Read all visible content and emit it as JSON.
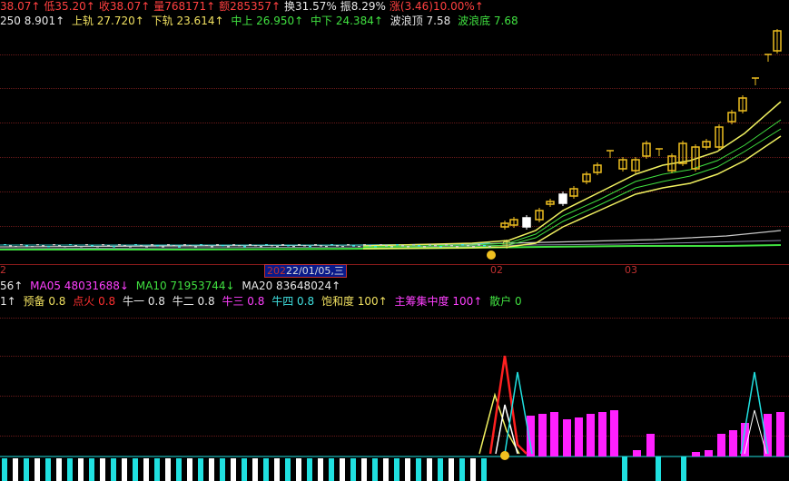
{
  "quote_bar": {
    "open_tail": {
      "text": "38.07↑",
      "color": "#ff4040"
    },
    "low": {
      "text": "低35.20↑",
      "color": "#ff4040"
    },
    "close": {
      "text": "收38.07↑",
      "color": "#ff4040"
    },
    "volume": {
      "text": "量768171↑",
      "color": "#ff4040"
    },
    "amount": {
      "text": "额285357↑",
      "color": "#ff4040"
    },
    "turnover": {
      "text": "换31.57%",
      "color": "#e8e8e8"
    },
    "amplitude": {
      "text": "振8.29%",
      "color": "#e8e8e8"
    },
    "change": {
      "text": "涨(3.46)10.00%↑",
      "color": "#ff4040"
    }
  },
  "indicator_bar": {
    "ma250": {
      "text": "250 8.901↑",
      "color": "#e8e8e8"
    },
    "upper": {
      "text": "上轨 27.720↑",
      "color": "#f0e060"
    },
    "lower": {
      "text": "下轨 23.614↑",
      "color": "#f0e060"
    },
    "mid_up": {
      "text": "中上 26.950↑",
      "color": "#40e040"
    },
    "mid_down": {
      "text": "中下 24.384↑",
      "color": "#40e040"
    },
    "wave_top": {
      "text": "波浪顶 7.58",
      "color": "#e8e8e8"
    },
    "wave_bottom": {
      "text": "波浪底 7.68",
      "color": "#40e040"
    }
  },
  "date_axis": {
    "tick_left": "2",
    "tick_year_prefix": "202",
    "current_date": "22/01/05,三",
    "tick_02": "02",
    "tick_03": "03"
  },
  "volume_bar": {
    "tail": {
      "text": "56↑",
      "color": "#e8e8e8"
    },
    "ma05": {
      "text": "MA05 48031688↓",
      "color": "#ff40ff"
    },
    "ma10": {
      "text": "MA10 71953744↓",
      "color": "#40e040"
    },
    "ma20": {
      "text": "MA20 83648024↑",
      "color": "#e8e8e8"
    }
  },
  "signal_bar": {
    "tail": {
      "text": "1↑",
      "color": "#e8e8e8"
    },
    "prepare": {
      "text": "预备 0.8",
      "color": "#f0e060"
    },
    "ignite": {
      "text": "点火 0.8",
      "color": "#ff3030"
    },
    "bull1": {
      "text": "牛一 0.8",
      "color": "#e8e8e8"
    },
    "bull2": {
      "text": "牛二 0.8",
      "color": "#e8e8e8"
    },
    "bull3": {
      "text": "牛三 0.8",
      "color": "#ff40ff"
    },
    "bull4": {
      "text": "牛四 0.8",
      "color": "#40e0e0"
    },
    "saturation": {
      "text": "饱和度 100↑",
      "color": "#f0e060"
    },
    "main_concentration": {
      "text": "主筹集中度 100↑",
      "color": "#ff40ff"
    },
    "retail": {
      "text": "散户 0",
      "color": "#40e040"
    }
  },
  "colors": {
    "background": "#000000",
    "grid": "#6a1a1a",
    "candle_up": "#f0c020",
    "ma_band": "#f0f060",
    "ma_green": "#40e040",
    "ma_white": "#c8c8c8",
    "hist_magenta": "#ff20ff",
    "hist_cyan": "#20e0e0",
    "hist_white": "#ffffff",
    "signal_red": "#ff2020"
  },
  "icons": {
    "smiley_main": "smiley-face-icon",
    "smiley_lower": "smiley-face-icon"
  }
}
